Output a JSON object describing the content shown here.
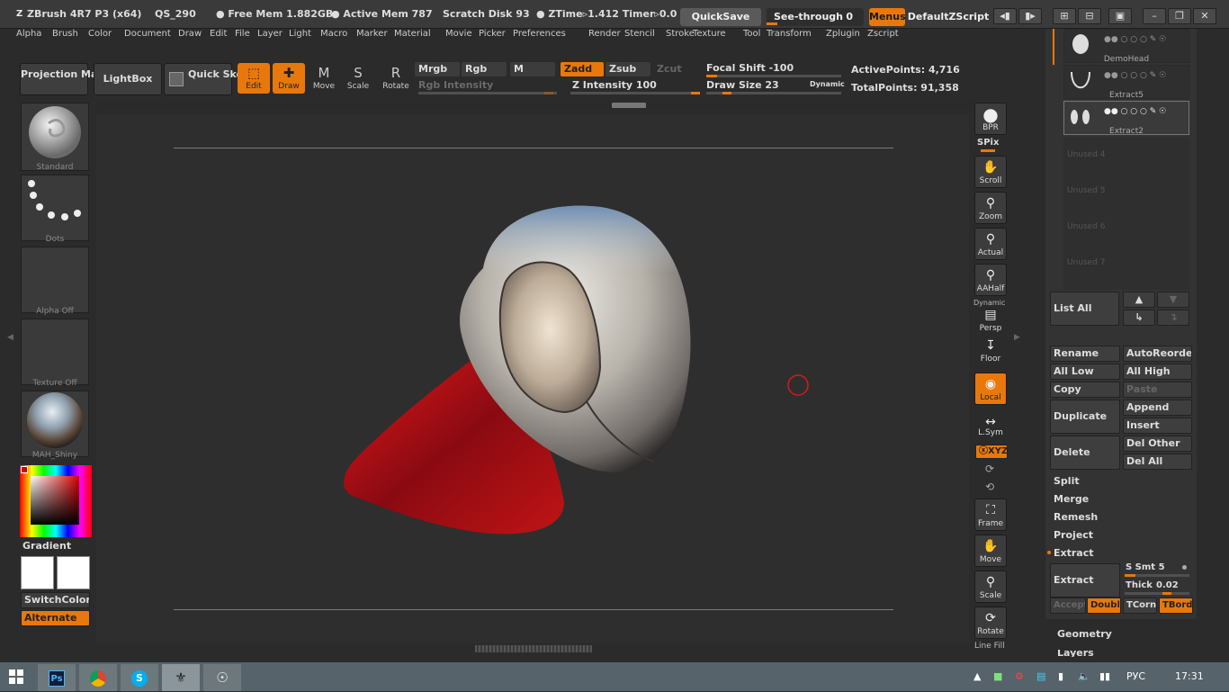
{
  "titlebar": {
    "app": "ZBrush 4R7 P3 (x64)",
    "qs": "QS_290",
    "free_mem": "● Free Mem 1.882GB",
    "active_mem": "● Active Mem 787",
    "scratch": "Scratch Disk 93",
    "ztime": "● ZTime▹1.412 Timer▹0.0",
    "quicksave": "QuickSave",
    "seethrough": "See-through",
    "seethrough_val": "0",
    "menus": "Menus",
    "zscript": "DefaultZScript"
  },
  "menus": [
    "Alpha",
    "Brush",
    "Color",
    "Document",
    "Draw",
    "Edit",
    "File",
    "Layer",
    "Light",
    "Macro",
    "Marker",
    "Material",
    "Movie",
    "Picker",
    "Preferences",
    "Render",
    "Stencil",
    "Stroke",
    "Texture",
    "Tool",
    "Transform",
    "Zplugin",
    "Zscript"
  ],
  "toolbar": {
    "projection_master": "Projection Master",
    "lightbox": "LightBox",
    "quick_sketch": "Quick Sketch",
    "edit": "Edit",
    "draw": "Draw",
    "move": "Move",
    "scale": "Scale",
    "rotate": "Rotate",
    "mrgb": "Mrgb",
    "rgb": "Rgb",
    "m": "M",
    "zadd": "Zadd",
    "zsub": "Zsub",
    "zcut": "Zcut",
    "rgb_intensity": "Rgb Intensity",
    "z_intensity": "Z Intensity 100",
    "focal_shift": "Focal Shift -100",
    "draw_size": "Draw Size 23",
    "dynamic": "Dynamic",
    "active_points": "ActivePoints: 4,716",
    "total_points": "TotalPoints: 91,358"
  },
  "left": {
    "brush": "Standard",
    "stroke": "Dots",
    "alpha": "Alpha Off",
    "texture": "Texture Off",
    "material": "MAH_Shiny",
    "gradient": "Gradient",
    "switchcolor": "SwitchColor",
    "alternate": "Alternate"
  },
  "right_shelf": {
    "bpr": "BPR",
    "spix": "SPix",
    "scroll": "Scroll",
    "zoom": "Zoom",
    "actual": "Actual",
    "aahalf": "AAHalf",
    "dynamic": "Dynamic",
    "persp": "Persp",
    "floor": "Floor",
    "local": "Local",
    "lsym": "L.Sym",
    "xyz": "ⓧXYZ",
    "frame": "Frame",
    "move": "Move",
    "scale": "Scale",
    "rotate": "Rotate",
    "linefill": "Line Fill"
  },
  "subtools": {
    "items": [
      {
        "name": "DemoHead"
      },
      {
        "name": "Extract5"
      },
      {
        "name": "Extract2"
      }
    ],
    "unused": [
      "Unused 4",
      "Unused 5",
      "Unused 6",
      "Unused 7"
    ],
    "list_all": "List All",
    "rename": "Rename",
    "autoreorder": "AutoReorder",
    "all_low": "All Low",
    "all_high": "All High",
    "copy": "Copy",
    "paste": "Paste",
    "duplicate": "Duplicate",
    "append": "Append",
    "insert": "Insert",
    "delete": "Delete",
    "del_other": "Del Other",
    "del_all": "Del All",
    "split": "Split",
    "merge": "Merge",
    "remesh": "Remesh",
    "project": "Project",
    "extract_section": "Extract",
    "extract_btn": "Extract",
    "s_smt": "S Smt 5",
    "thick": "Thick",
    "thick_val": "0.02",
    "accept": "Accept",
    "double": "Double",
    "tcorner": "TCorner",
    "tborder": "TBorder",
    "geometry": "Geometry",
    "layers_peek": "Layers"
  },
  "taskbar": {
    "lang": "РУС",
    "time": "17:31",
    "apps": [
      "Ps",
      "Chrome",
      "S",
      "ZBrush",
      "Zoom"
    ]
  },
  "colors": {
    "accent": "#e8780c",
    "panel": "#333333",
    "viewport": "#2e2e2e"
  }
}
